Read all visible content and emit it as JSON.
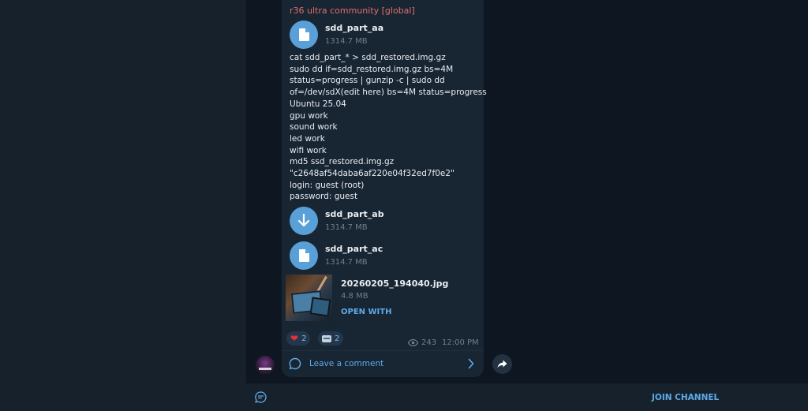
{
  "message": {
    "channel_title": "r36 ultra community [global]",
    "files": [
      {
        "name": "sdd_part_aa",
        "size": "1314.7 MB",
        "icon": "file-icon"
      },
      {
        "name": "sdd_part_ab",
        "size": "1314.7 MB",
        "icon": "download-icon"
      },
      {
        "name": "sdd_part_ac",
        "size": "1314.7 MB",
        "icon": "file-icon"
      }
    ],
    "text_lines": [
      "cat sdd_part_* > sdd_restored.img.gz",
      "sudo dd if=sdd_restored.img.gz bs=4M",
      "status=progress | gunzip -c | sudo dd",
      "of=/dev/sdX(edit here) bs=4M status=progress",
      "Ubuntu 25.04",
      "gpu work",
      "sound work",
      "led work",
      "wifi work",
      "md5 ssd_restored.img.gz",
      "\"c2648af54daba6af220e04f32ed7f0e2\"",
      "login: guest (root)",
      "password: guest"
    ],
    "photo": {
      "name": "20260205_194040.jpg",
      "size": "4.8 MB",
      "action": "OPEN WITH"
    },
    "reactions": [
      {
        "emoji": "red-heart",
        "count": "2"
      },
      {
        "emoji": "emoji-sticker",
        "count": "2"
      }
    ],
    "views": "243",
    "time": "12:00 PM",
    "comment_label": "Leave a comment"
  },
  "bottom_bar": {
    "join_label": "JOIN CHANNEL"
  },
  "colors": {
    "background": "#0e1621",
    "bubble": "#182533",
    "accent": "#5eabea",
    "channel_title": "#e06d6d",
    "file_icon": "#5aa0d8"
  }
}
